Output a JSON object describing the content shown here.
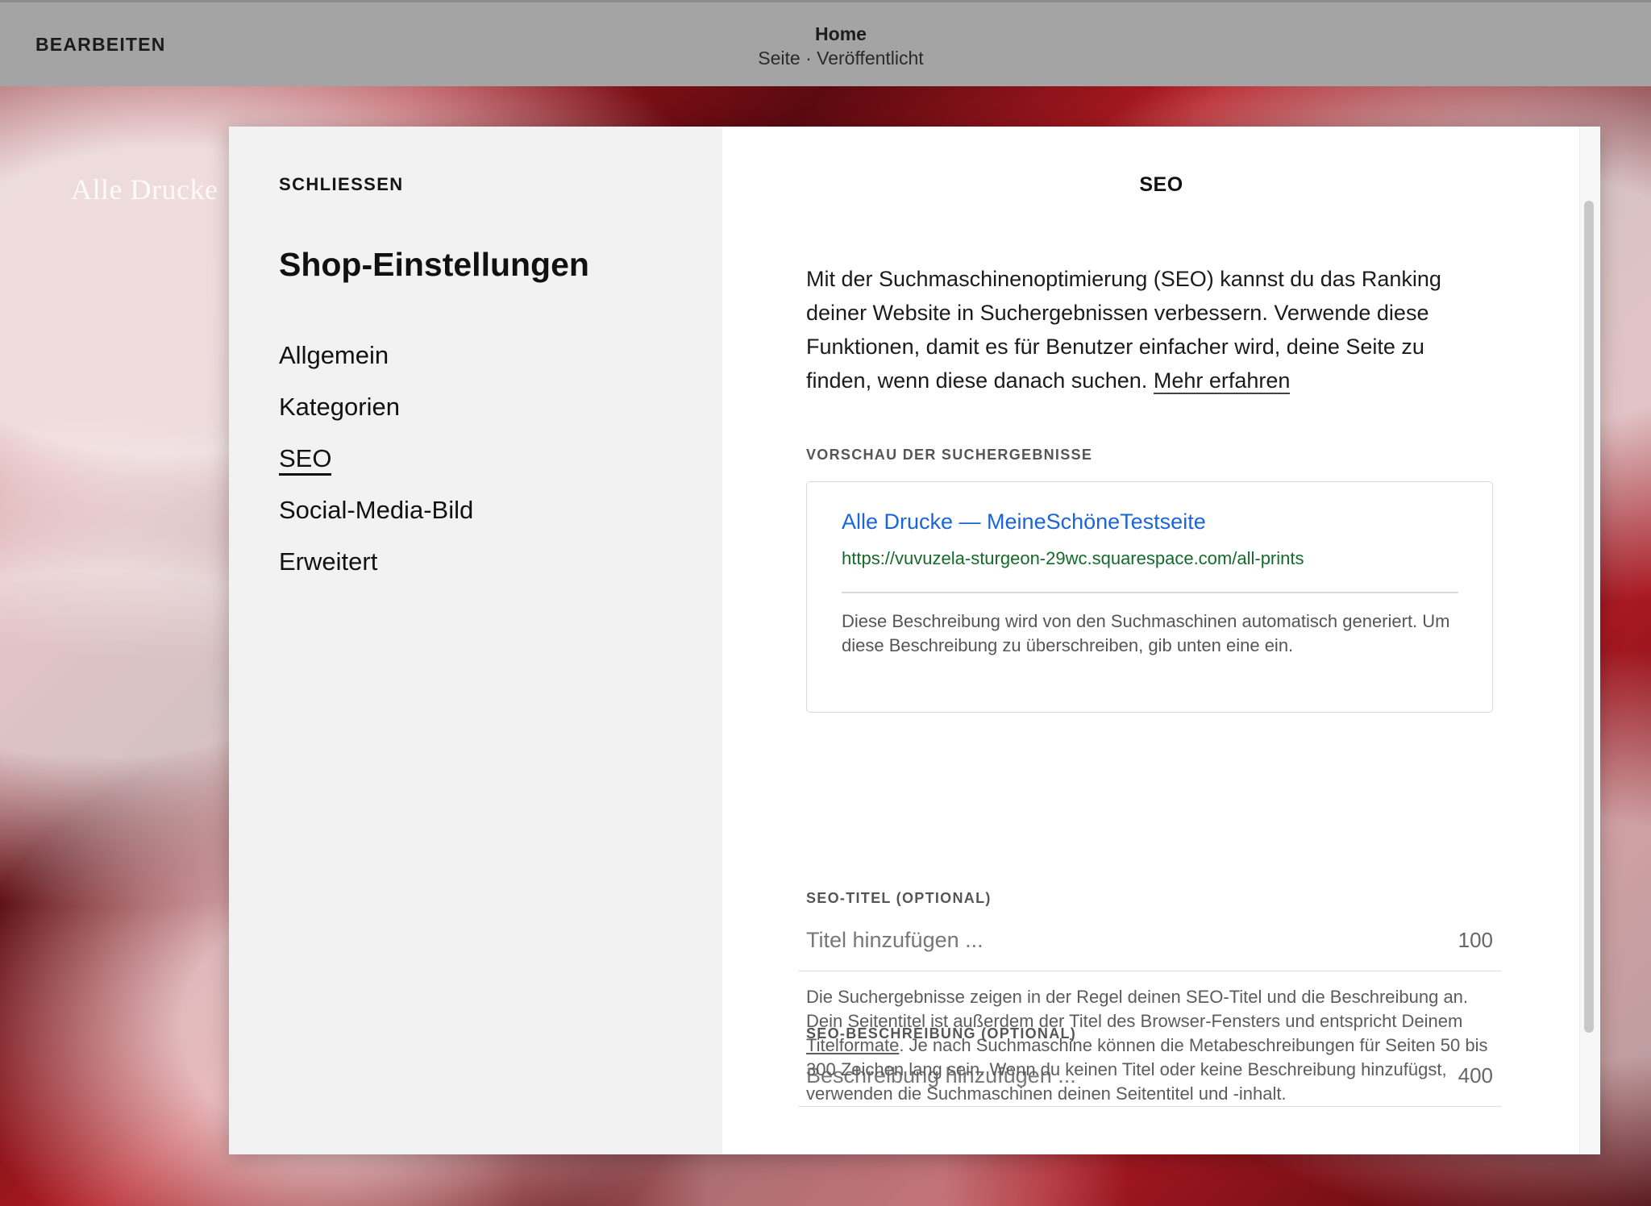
{
  "topbar": {
    "edit_label": "BEARBEITEN",
    "page_title": "Home",
    "page_subtitle": "Seite · Veröffentlicht"
  },
  "site": {
    "title": "Alle Drucke"
  },
  "modal": {
    "close_label": "SCHLIESSEN",
    "heading": "Shop-Einstellungen",
    "nav": [
      {
        "label": "Allgemein",
        "active": false
      },
      {
        "label": "Kategorien",
        "active": false
      },
      {
        "label": "SEO",
        "active": true
      },
      {
        "label": "Social-Media-Bild",
        "active": false
      },
      {
        "label": "Erweitert",
        "active": false
      }
    ]
  },
  "seo": {
    "title": "SEO",
    "intro_text": "Mit der Suchmaschinenoptimierung (SEO) kannst du das Ranking deiner Website in Suchergebnissen verbessern. Verwende diese Funktionen, damit es für Benutzer einfacher wird, deine Seite zu finden, wenn diese danach suchen.",
    "learn_more": "Mehr erfahren",
    "preview_label": "VORSCHAU DER SUCHERGEBNISSE",
    "preview": {
      "title": "Alle Drucke — MeineSchöneTestseite",
      "url": "https://vuvuzela-sturgeon-29wc.squarespace.com/all-prints",
      "description": "Diese Beschreibung wird von den Suchmaschinen automatisch generiert. Um diese Beschreibung zu überschreiben, gib unten eine ein."
    },
    "seo_title_label": "SEO-TITEL (OPTIONAL)",
    "seo_title_placeholder": "Titel hinzufügen ...",
    "seo_title_count": "100",
    "seo_desc_label": "SEO-BESCHREIBUNG (OPTIONAL)",
    "seo_desc_placeholder": "Beschreibung hinzufügen ...",
    "seo_desc_count": "400",
    "help_before": "Die Suchergebnisse zeigen in der Regel deinen SEO-Titel und die Beschreibung an. Dein Seitentitel ist außerdem der Titel des Browser-Fensters und entspricht Deinem ",
    "help_link": "Titelformate",
    "help_after": ". Je nach Suchmaschine können die Metabeschreibungen für Seiten 50 bis 300 Zeichen lang sein. Wenn du keinen Titel oder keine Beschreibung hinzufügst, verwenden die Suchmaschinen deinen Seitentitel und -inhalt."
  },
  "colors": {
    "link_blue": "#1a66d6",
    "url_green": "#156a2a",
    "topbar_gray": "#a4a4a4",
    "left_panel": "#f2f2f2"
  }
}
